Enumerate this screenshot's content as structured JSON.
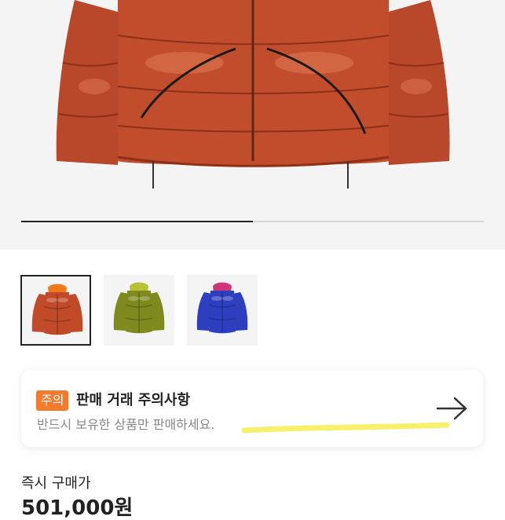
{
  "product": {
    "image_icon": "orange-down-jacket-photo",
    "gallery_progress": 0.5,
    "thumbnails": [
      {
        "icon": "orange-puffer-jacket",
        "color": "#c14a28",
        "accent": "#f07a1a",
        "selected": true
      },
      {
        "icon": "olive-puffer-jacket",
        "color": "#7e8a1e",
        "accent": "#b6c232",
        "selected": false
      },
      {
        "icon": "blue-puffer-jacket",
        "color": "#2d3fbf",
        "accent": "#d0357a",
        "selected": false
      }
    ]
  },
  "notice": {
    "badge": "주의",
    "title": "판매 거래 주의사항",
    "subtitle": "반드시 보유한 상품만 판매하세요.",
    "arrow_icon": "arrow-right-icon",
    "badge_color": "#f47a2e",
    "highlight_color": "#f6f06a"
  },
  "price": {
    "label": "즉시 구매가",
    "value": "501,000원"
  }
}
